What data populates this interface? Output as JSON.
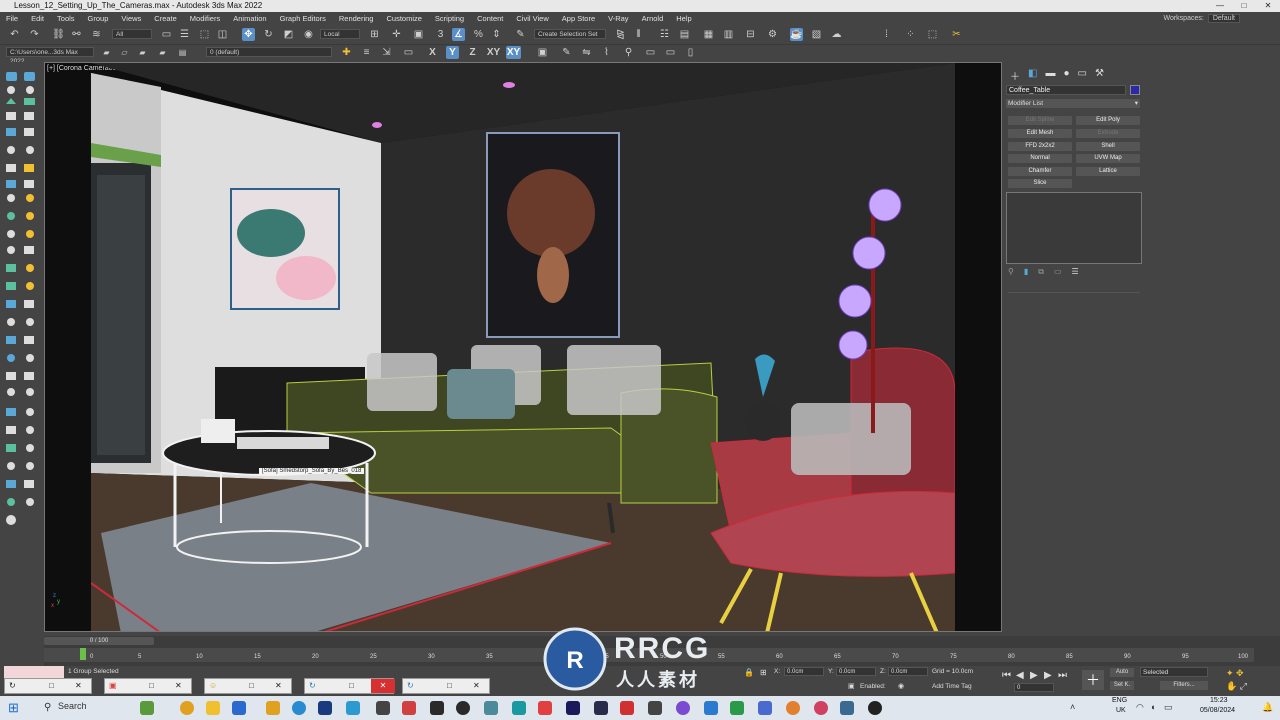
{
  "window": {
    "title": "Lesson_12_Setting_Up_The_Cameras.max - Autodesk 3ds Max 2022",
    "min_label": "—",
    "max_label": "□",
    "close_label": "✕"
  },
  "menu": [
    "File",
    "Edit",
    "Tools",
    "Group",
    "Views",
    "Create",
    "Modifiers",
    "Animation",
    "Graph Editors",
    "Rendering",
    "Customize",
    "Scripting",
    "Content",
    "Civil View",
    "App Store",
    "V-Ray",
    "Arnold",
    "Help"
  ],
  "workspace": {
    "label": "Workspaces:",
    "value": "Default"
  },
  "toolbar": {
    "selection_filter": "All",
    "ref_coord": "Local",
    "selection_set": "Create Selection Set",
    "project_path": "C:\\Users\\one...3ds Max 2022",
    "layer": "0 (default)",
    "axis_x": "X",
    "axis_y": "Y",
    "axis_z": "Z",
    "axis_xy": "XY",
    "axis_xy2": "XY"
  },
  "viewport": {
    "label": "[+] [Corona Camera002 ] [Standard ] [Edged Faces ]",
    "tooltip": "[Sofa] Smedstorp_Sofa_By_Bes_018",
    "axis_x": "x",
    "axis_y": "y",
    "axis_z": "z"
  },
  "command_panel": {
    "object_name": "Coffee_Table",
    "object_color": "#2a2aa8",
    "modifier_list": "Modifier List",
    "buttons": [
      {
        "label": "Edit Spline",
        "enabled": false
      },
      {
        "label": "Edit Poly",
        "enabled": true
      },
      {
        "label": "Edit Mesh",
        "enabled": true
      },
      {
        "label": "Extrude",
        "enabled": false
      },
      {
        "label": "FFD 2x2x2",
        "enabled": true
      },
      {
        "label": "Shell",
        "enabled": true
      },
      {
        "label": "Normal",
        "enabled": true
      },
      {
        "label": "UVW Map",
        "enabled": true
      },
      {
        "label": "Chamfer",
        "enabled": true
      },
      {
        "label": "Lattice",
        "enabled": true
      },
      {
        "label": "Slice",
        "enabled": true
      }
    ]
  },
  "timeline": {
    "frame": "0 / 100",
    "ticks": [
      "0",
      "5",
      "10",
      "15",
      "20",
      "25",
      "30",
      "35",
      "40",
      "45",
      "50",
      "55",
      "60",
      "65",
      "70",
      "75",
      "80",
      "85",
      "90",
      "95",
      "100"
    ]
  },
  "status": {
    "selection": "1 Group Selected",
    "x_label": "X:",
    "x_value": "0.0cm",
    "y_label": "Y:",
    "y_value": "0.0cm",
    "z_label": "Z:",
    "z_value": "0.0cm",
    "grid": "Grid = 10.0cm",
    "enabled": "Enabled:",
    "add_time_tag": "Add Time Tag",
    "auto": "Auto",
    "set_k": "Set K.",
    "selected": "Selected",
    "filters": "Filters...",
    "frame_field": "0"
  },
  "taskbar": {
    "search": "Search",
    "lang": "ENG",
    "region": "UK",
    "time": "15:23",
    "date": "05/08/2024"
  },
  "watermark": {
    "main": "RRCG",
    "sub": "人人素材"
  },
  "colors": {
    "accent": "#5a8fc7",
    "selection_wire": "#cc2a3a",
    "sofa_wire": "#b8d040"
  }
}
